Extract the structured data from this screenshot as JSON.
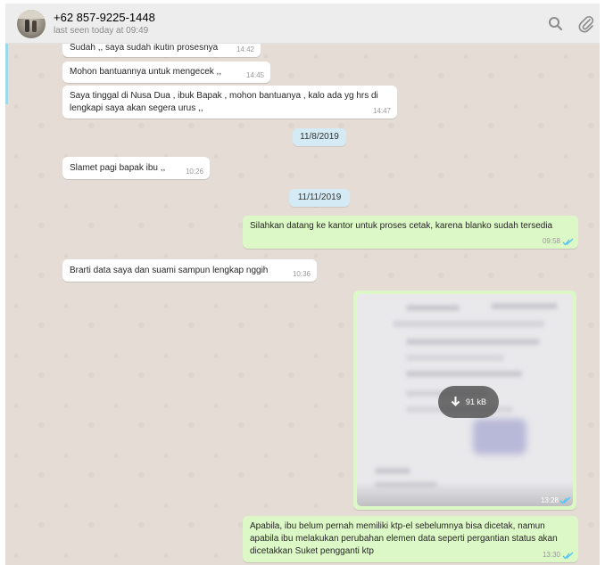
{
  "header": {
    "contact_name": "+62 857-9225-1448",
    "status": "last seen today at 09:49"
  },
  "messages": [
    {
      "text": "Sudah ,, saya sudah ikutin prosesnya",
      "time": "14:42",
      "direction": "in"
    },
    {
      "text": "Mohon bantuannya untuk mengecek ,,",
      "time": "14:45",
      "direction": "in"
    },
    {
      "text_line1": "Saya tinggal di Nusa Dua , ibuk Bapak , mohon bantuanya , kalo ada yg hrs di",
      "text_line2": "lengkapi saya akan segera urus ,,",
      "time": "14:47",
      "direction": "in"
    },
    {
      "text": "Slamet pagi bapak ibu ,,",
      "time": "10:26",
      "direction": "in"
    },
    {
      "text": "Silahkan datang ke kantor untuk proses cetak, karena blanko sudah tersedia",
      "time": "09:58",
      "direction": "out"
    },
    {
      "text": "Brarti data saya dan suami sampun lengkap nggih",
      "time": "10:36",
      "direction": "in"
    },
    {
      "type": "image",
      "size": "91 kB",
      "time": "13:28",
      "direction": "out"
    },
    {
      "text_line1": "Apabila, ibu belum pernah memiliki ktp-el sebelumnya bisa dicetak, namun",
      "text_line2": "apabila ibu melakukan perubahan elemen data seperti pergantian status akan",
      "text_line3": "dicetakkan Suket pengganti ktp",
      "time": "13:30",
      "direction": "out"
    }
  ],
  "date_dividers": [
    "11/8/2019",
    "11/11/2019"
  ],
  "icons": {
    "search": "search-icon",
    "attach": "paperclip-icon",
    "download": "download-arrow-icon",
    "read": "double-check-icon"
  },
  "colors": {
    "outgoing": "#dcf8c6",
    "incoming": "#ffffff",
    "ticks": "#4fc3f7",
    "date_chip": "#d4eaf4",
    "chat_bg": "#e5ddd5"
  }
}
